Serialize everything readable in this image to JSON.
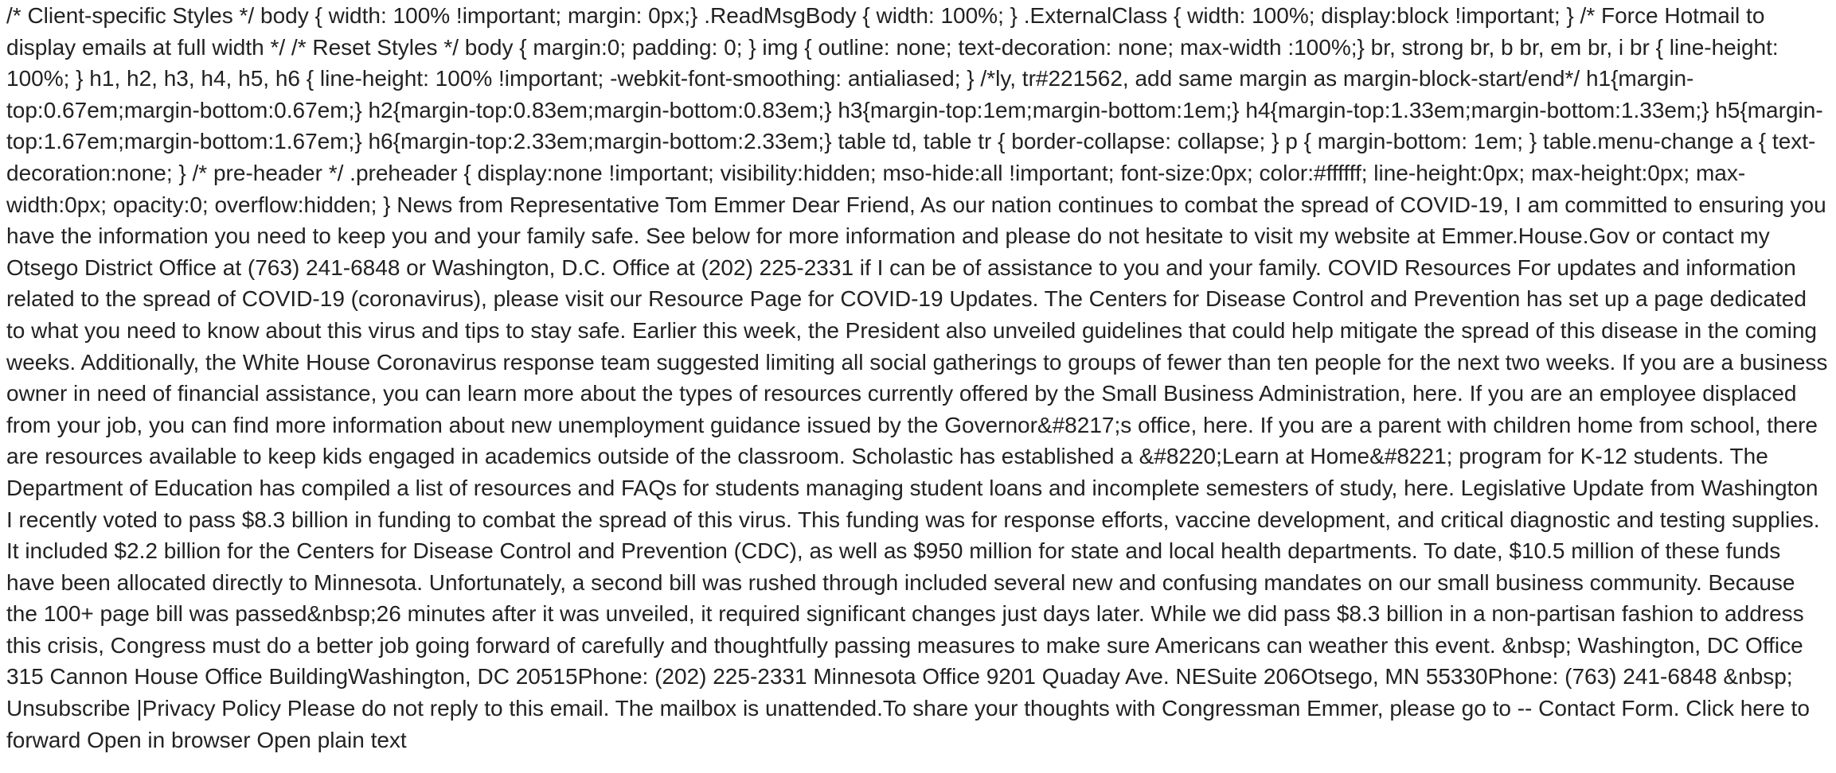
{
  "email": {
    "text": "/* Client-specific Styles */ body { width: 100% !important; margin: 0px;} .ReadMsgBody { width: 100%; } .ExternalClass { width: 100%; display:block !important; } /* Force Hotmail to display emails at full width */ /* Reset Styles */ body { margin:0; padding: 0; } img { outline: none; text-decoration: none; max-width :100%;} br, strong br, b br, em br, i br { line-height: 100%; } h1, h2, h3, h4, h5, h6 { line-height: 100% !important; -webkit-font-smoothing: antialiased; } /*ly, tr#221562, add same margin as margin-block-start/end*/ h1{margin-top:0.67em;margin-bottom:0.67em;} h2{margin-top:0.83em;margin-bottom:0.83em;} h3{margin-top:1em;margin-bottom:1em;} h4{margin-top:1.33em;margin-bottom:1.33em;} h5{margin-top:1.67em;margin-bottom:1.67em;} h6{margin-top:2.33em;margin-bottom:2.33em;} table td, table tr { border-collapse: collapse; } p { margin-bottom: 1em; } table.menu-change a { text-decoration:none; } /* pre-header */ .preheader { display:none !important; visibility:hidden; mso-hide:all !important; font-size:0px; color:#ffffff; line-height:0px; max-height:0px; max-width:0px; opacity:0; overflow:hidden; } News from Representative Tom Emmer Dear Friend, As our nation continues to combat the spread of COVID-19, I am committed to ensuring you have the information you need to keep you and your family safe. See below for more information and please do not hesitate to visit my website at Emmer.House.Gov or contact my Otsego District Office at (763) 241-6848 or Washington, D.C. Office at (202) 225-2331 if I can be of assistance to you and your family. COVID Resources For updates and information related to the spread of COVID-19 (coronavirus), please visit our Resource Page for COVID-19 Updates. The Centers for Disease Control and Prevention has set up a page dedicated to what you need to know about this virus and tips to stay safe. Earlier this week, the President also unveiled guidelines that could help mitigate the spread of this disease in the coming weeks. Additionally, the White House Coronavirus response team suggested limiting all social gatherings to groups of fewer than ten people for the next two weeks. If you are a business owner in need of financial assistance, you can learn more about the types of resources currently offered by the Small Business Administration, here. If you are an employee displaced from your job, you can find more information about new unemployment guidance issued by the Governor&#8217;s office, here. If you are a parent with children home from school, there are resources available to keep kids engaged in academics outside of the classroom. Scholastic has established a &#8220;Learn at Home&#8221; program for K-12 students. The Department of Education has compiled a list of resources and FAQs for students managing student loans and incomplete semesters of study, here. Legislative Update from Washington I recently voted to pass $8.3 billion in funding to combat the spread of this virus. This funding was for response efforts, vaccine development, and critical diagnostic and testing supplies. It included $2.2 billion for the Centers for Disease Control and Prevention (CDC), as well as $950 million for state and local health departments. To date, $10.5 million of these funds have been allocated directly to Minnesota. Unfortunately, a second bill was rushed through included several new and confusing mandates on our small business community. Because the 100+ page bill was passed&nbsp;26 minutes after it was unveiled, it required significant changes just days later. While we did pass $8.3 billion in a non-partisan fashion to address this crisis, Congress must do a better job going forward of carefully and thoughtfully passing measures to make sure Americans can weather this event. &nbsp; Washington, DC Office 315 Cannon House Office BuildingWashington, DC 20515Phone: (202) 225-2331 Minnesota Office 9201 Quaday Ave. NESuite 206Otsego, MN 55330Phone: (763) 241-6848 &nbsp; Unsubscribe |Privacy Policy Please do not reply to this email. The mailbox is unattended.To share your thoughts with Congressman Emmer, please go to -- Contact Form. Click here to forward Open in browser Open plain text"
  }
}
